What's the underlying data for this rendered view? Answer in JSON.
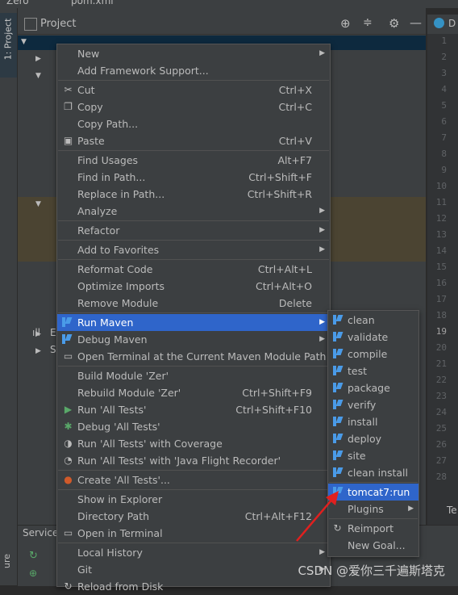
{
  "window": {
    "breadcrumb": [
      "Zero",
      "pom.xml"
    ],
    "side_tab": "1: Project",
    "project_title": "Project",
    "editor_tab": "D",
    "bottom_tab": "Te",
    "services_label": "Service",
    "bottom_left_label": "ure",
    "tree_letters": [
      "Ex",
      "Sc"
    ]
  },
  "line_numbers": [
    "1",
    "2",
    "3",
    "4",
    "5",
    "6",
    "7",
    "8",
    "9",
    "10",
    "11",
    "12",
    "13",
    "14",
    "15",
    "16",
    "17",
    "18",
    "19",
    "20",
    "21",
    "22",
    "23",
    "24",
    "25",
    "26",
    "27",
    "28"
  ],
  "context_menu": {
    "items": [
      {
        "label": "New",
        "shortcut": "",
        "submenu": true,
        "icon": ""
      },
      {
        "label": "Add Framework Support...",
        "shortcut": "",
        "submenu": false,
        "icon": ""
      },
      {
        "sep": true
      },
      {
        "label": "Cut",
        "shortcut": "Ctrl+X",
        "submenu": false,
        "icon": "cut-icon"
      },
      {
        "label": "Copy",
        "shortcut": "Ctrl+C",
        "submenu": false,
        "icon": "copy-icon"
      },
      {
        "label": "Copy Path...",
        "shortcut": "",
        "submenu": false,
        "icon": ""
      },
      {
        "label": "Paste",
        "shortcut": "Ctrl+V",
        "submenu": false,
        "icon": "paste-icon"
      },
      {
        "sep": true
      },
      {
        "label": "Find Usages",
        "shortcut": "Alt+F7",
        "submenu": false,
        "icon": ""
      },
      {
        "label": "Find in Path...",
        "shortcut": "Ctrl+Shift+F",
        "submenu": false,
        "icon": ""
      },
      {
        "label": "Replace in Path...",
        "shortcut": "Ctrl+Shift+R",
        "submenu": false,
        "icon": ""
      },
      {
        "label": "Analyze",
        "shortcut": "",
        "submenu": true,
        "icon": ""
      },
      {
        "sep": true
      },
      {
        "label": "Refactor",
        "shortcut": "",
        "submenu": true,
        "icon": ""
      },
      {
        "sep": true
      },
      {
        "label": "Add to Favorites",
        "shortcut": "",
        "submenu": true,
        "icon": ""
      },
      {
        "sep": true
      },
      {
        "label": "Reformat Code",
        "shortcut": "Ctrl+Alt+L",
        "submenu": false,
        "icon": ""
      },
      {
        "label": "Optimize Imports",
        "shortcut": "Ctrl+Alt+O",
        "submenu": false,
        "icon": ""
      },
      {
        "label": "Remove Module",
        "shortcut": "Delete",
        "submenu": false,
        "icon": ""
      },
      {
        "sep": true
      },
      {
        "label": "Run Maven",
        "shortcut": "",
        "submenu": true,
        "icon": "maven-icon",
        "selected": true
      },
      {
        "label": "Debug Maven",
        "shortcut": "",
        "submenu": true,
        "icon": "maven-icon"
      },
      {
        "label": "Open Terminal at the Current Maven Module Path",
        "shortcut": "",
        "submenu": false,
        "icon": "terminal-icon"
      },
      {
        "sep": true
      },
      {
        "label": "Build Module 'Zer'",
        "shortcut": "",
        "submenu": false,
        "icon": ""
      },
      {
        "label": "Rebuild Module 'Zer'",
        "shortcut": "Ctrl+Shift+F9",
        "submenu": false,
        "icon": ""
      },
      {
        "label": "Run 'All Tests'",
        "shortcut": "Ctrl+Shift+F10",
        "submenu": false,
        "icon": "run-icon"
      },
      {
        "label": "Debug 'All Tests'",
        "shortcut": "",
        "submenu": false,
        "icon": "debug-icon"
      },
      {
        "label": "Run 'All Tests' with Coverage",
        "shortcut": "",
        "submenu": false,
        "icon": "coverage-icon"
      },
      {
        "label": "Run 'All Tests' with 'Java Flight Recorder'",
        "shortcut": "",
        "submenu": false,
        "icon": "profiler-icon"
      },
      {
        "sep": true
      },
      {
        "label": "Create 'All Tests'...",
        "shortcut": "",
        "submenu": false,
        "icon": "create-test-icon"
      },
      {
        "sep": true
      },
      {
        "label": "Show in Explorer",
        "shortcut": "",
        "submenu": false,
        "icon": ""
      },
      {
        "label": "Directory Path",
        "shortcut": "Ctrl+Alt+F12",
        "submenu": false,
        "icon": ""
      },
      {
        "label": "Open in Terminal",
        "shortcut": "",
        "submenu": false,
        "icon": "terminal-icon"
      },
      {
        "sep": true
      },
      {
        "label": "Local History",
        "shortcut": "",
        "submenu": true,
        "icon": ""
      },
      {
        "label": "Git",
        "shortcut": "",
        "submenu": true,
        "icon": ""
      },
      {
        "label": "Reload from Disk",
        "shortcut": "",
        "submenu": false,
        "icon": "reload-icon"
      }
    ]
  },
  "maven_submenu": {
    "items": [
      {
        "label": "clean"
      },
      {
        "label": "validate"
      },
      {
        "label": "compile"
      },
      {
        "label": "test"
      },
      {
        "label": "package"
      },
      {
        "label": "verify"
      },
      {
        "label": "install"
      },
      {
        "label": "deploy"
      },
      {
        "label": "site"
      },
      {
        "label": "clean install"
      },
      {
        "sep": true
      },
      {
        "label": "tomcat7:run",
        "selected": true
      },
      {
        "label": "Plugins",
        "submenu": true,
        "plain": true
      },
      {
        "sep": true
      },
      {
        "label": "Reimport",
        "icon": "reimport-icon",
        "plain": true
      },
      {
        "label": "New Goal...",
        "plain": true
      }
    ]
  },
  "watermark": "CSDN @爱你三千遍斯塔克",
  "colors": {
    "accent": "#2f65ca",
    "maven": "#4a9be8",
    "annotation": "#e0201f"
  }
}
